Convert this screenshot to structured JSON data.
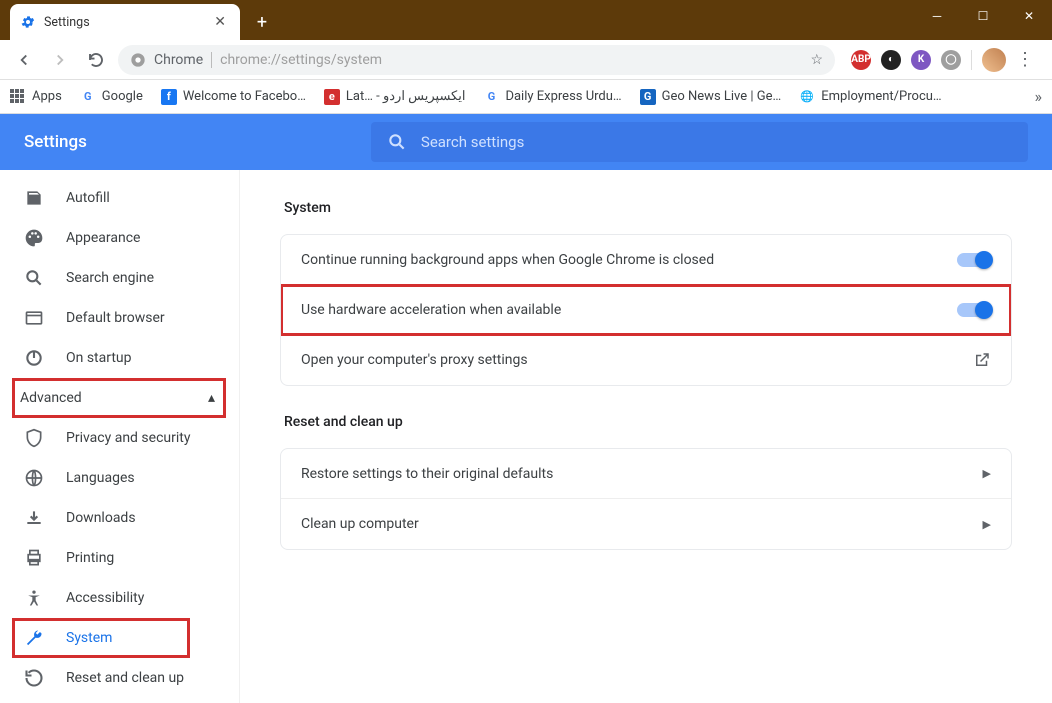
{
  "window": {
    "tab_title": "Settings"
  },
  "toolbar": {
    "chrome_label": "Chrome",
    "url": "chrome://settings/system"
  },
  "bookmarks": {
    "apps": "Apps",
    "items": [
      "Google",
      "Welcome to Facebo…",
      "Lat… - ایکسپریس اردو",
      "Daily Express Urdu…",
      "Geo News Live | Ge…",
      "Employment/Procu…"
    ]
  },
  "header": {
    "title": "Settings",
    "search_placeholder": "Search settings"
  },
  "sidebar": {
    "autofill": "Autofill",
    "appearance": "Appearance",
    "search_engine": "Search engine",
    "default_browser": "Default browser",
    "on_startup": "On startup",
    "advanced": "Advanced",
    "privacy": "Privacy and security",
    "languages": "Languages",
    "downloads": "Downloads",
    "printing": "Printing",
    "accessibility": "Accessibility",
    "system": "System",
    "reset": "Reset and clean up"
  },
  "main": {
    "system_title": "System",
    "bg_apps": "Continue running background apps when Google Chrome is closed",
    "hw_accel": "Use hardware acceleration when available",
    "proxy": "Open your computer's proxy settings",
    "reset_title": "Reset and clean up",
    "restore": "Restore settings to their original defaults",
    "cleanup": "Clean up computer"
  }
}
